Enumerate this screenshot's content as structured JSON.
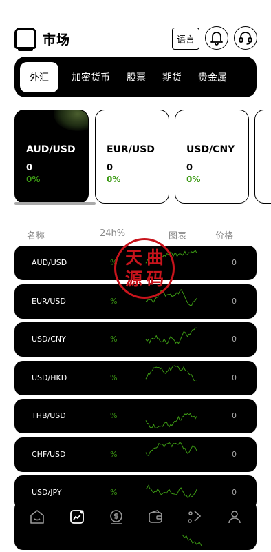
{
  "header": {
    "title": "市场",
    "lang_label": "语言"
  },
  "tabs": [
    {
      "label": "外汇",
      "active": true
    },
    {
      "label": "加密货币",
      "active": false
    },
    {
      "label": "股票",
      "active": false
    },
    {
      "label": "期货",
      "active": false
    },
    {
      "label": "贵金属",
      "active": false
    }
  ],
  "cards": [
    {
      "pair": "AUD/USD",
      "price": "0",
      "change": "0%"
    },
    {
      "pair": "EUR/USD",
      "price": "0",
      "change": "0%"
    },
    {
      "pair": "USD/CNY",
      "price": "0",
      "change": "0%"
    }
  ],
  "columns": {
    "name": "名称",
    "change": "24h%",
    "chart": "图表",
    "price": "价格"
  },
  "rows": [
    {
      "pair": "AUD/USD",
      "pct": "%",
      "price": "0"
    },
    {
      "pair": "EUR/USD",
      "pct": "%",
      "price": "0"
    },
    {
      "pair": "USD/CNY",
      "pct": "%",
      "price": "0"
    },
    {
      "pair": "USD/HKD",
      "pct": "%",
      "price": "0"
    },
    {
      "pair": "THB/USD",
      "pct": "%",
      "price": "0"
    },
    {
      "pair": "CHF/USD",
      "pct": "%",
      "price": "0"
    },
    {
      "pair": "USD/JPY",
      "pct": "%",
      "price": "0"
    }
  ],
  "watermark": [
    "天",
    "曲",
    "源",
    "码"
  ],
  "nav": [
    {
      "icon": "home-icon",
      "active": false
    },
    {
      "icon": "market-chart-icon",
      "active": true
    },
    {
      "icon": "trade-coin-icon",
      "active": false
    },
    {
      "icon": "wallet-icon",
      "active": false
    },
    {
      "icon": "share-icon",
      "active": false
    },
    {
      "icon": "profile-icon",
      "active": false
    }
  ],
  "colors": {
    "accent_green": "#3c9a14",
    "stamp_red": "#c8141c",
    "dark": "#000000"
  }
}
